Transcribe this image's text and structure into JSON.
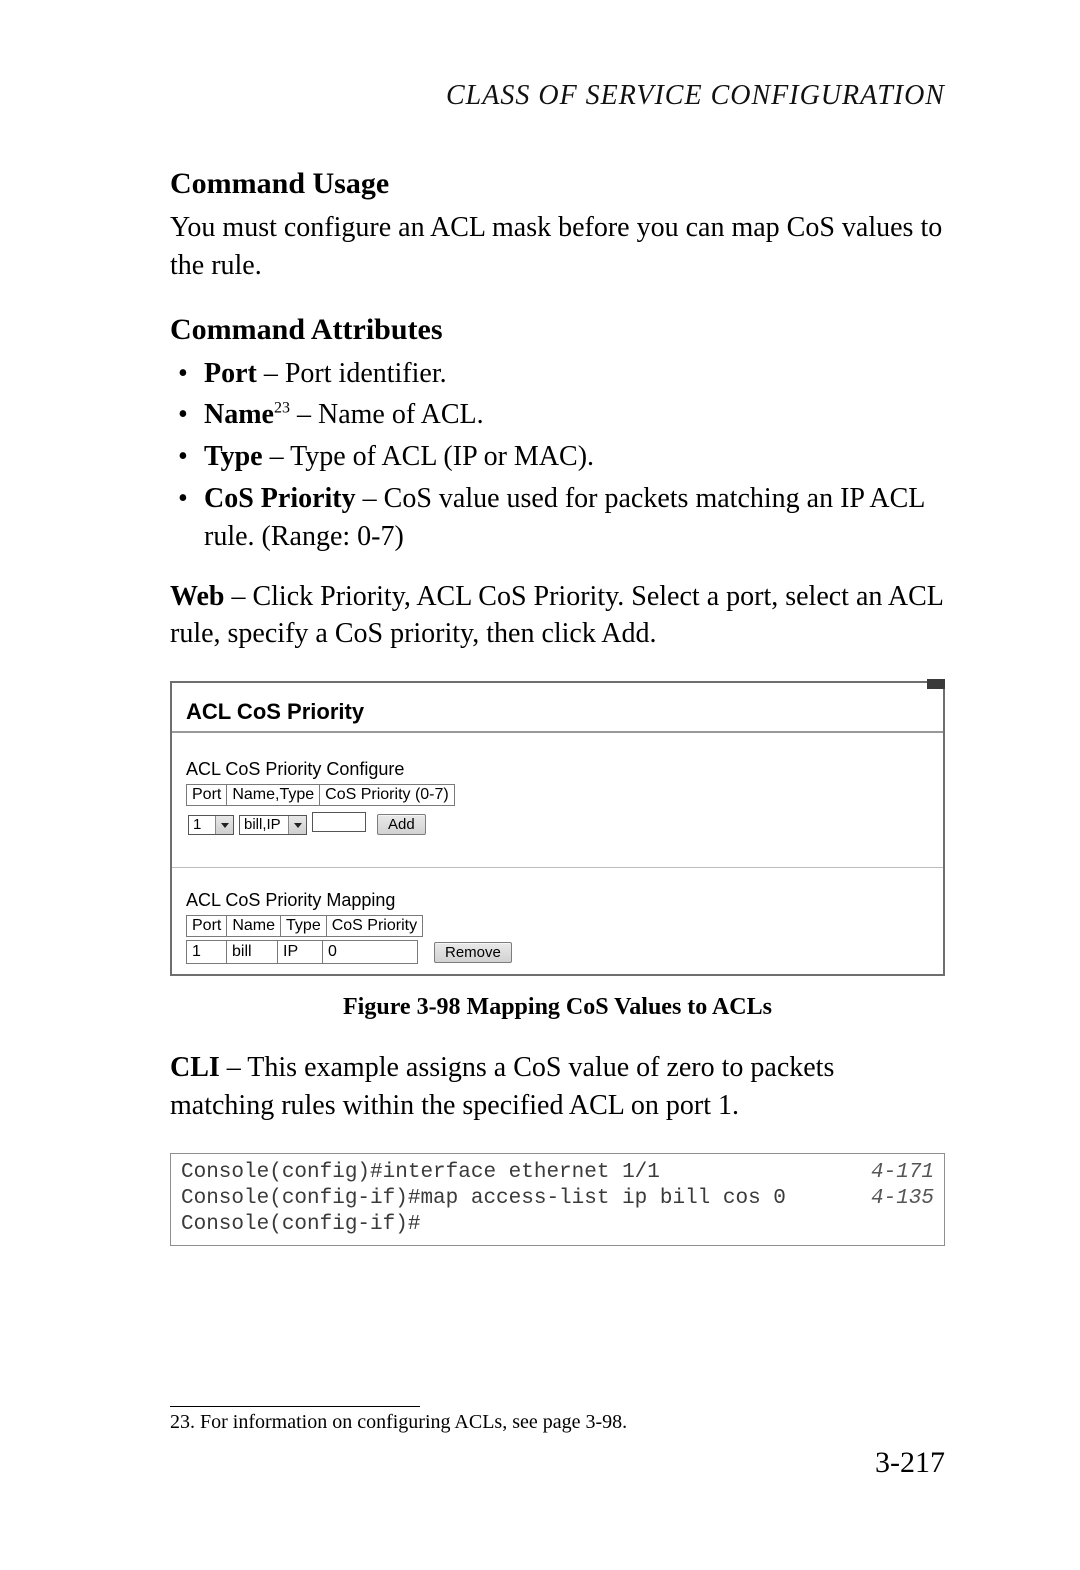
{
  "running_header": "CLASS OF SERVICE CONFIGURATION",
  "headings": {
    "command_usage": "Command Usage",
    "command_attributes": "Command Attributes"
  },
  "command_usage_text": "You must configure an ACL mask before you can map CoS values to the rule.",
  "attributes": {
    "port_label": "Port",
    "port_desc": " – Port identifier.",
    "name_label": "Name",
    "name_sup": "23",
    "name_desc": " – Name of ACL.",
    "type_label": "Type",
    "type_desc": " – Type of ACL (IP or MAC).",
    "cos_label": "CoS Priority",
    "cos_desc": " – CoS value used for packets matching an IP ACL rule. (Range: 0-7)"
  },
  "web_label": "Web",
  "web_text": " – Click Priority, ACL CoS Priority. Select a port, select an ACL rule, specify a CoS priority, then click Add.",
  "panel": {
    "title": "ACL CoS Priority",
    "configure_label": "ACL CoS Priority Configure",
    "headers": {
      "port": "Port",
      "nametype": "Name,Type",
      "cos": "CoS Priority (0-7)"
    },
    "port_value": "1",
    "nametype_value": "bill,IP",
    "add_btn": "Add",
    "mapping_label": "ACL CoS Priority Mapping",
    "map_headers": {
      "port": "Port",
      "name": "Name",
      "type": "Type",
      "cos": "CoS Priority"
    },
    "map_row": {
      "port": "1",
      "name": "bill",
      "type": "IP",
      "cos": "0"
    },
    "remove_btn": "Remove"
  },
  "caption": "Figure 3-98  Mapping CoS Values to ACLs",
  "cli_label": "CLI",
  "cli_text": " – This example assigns a CoS value of zero to packets matching rules within the specified ACL on port 1.",
  "cli": {
    "line1": "Console(config)#interface ethernet 1/1",
    "ref1": "4-171",
    "line2": "Console(config-if)#map access-list ip bill cos 0",
    "ref2": "4-135",
    "line3": "Console(config-if)#"
  },
  "footnote": "23.  For information on configuring ACLs, see page 3-98.",
  "page_number": "3-217"
}
